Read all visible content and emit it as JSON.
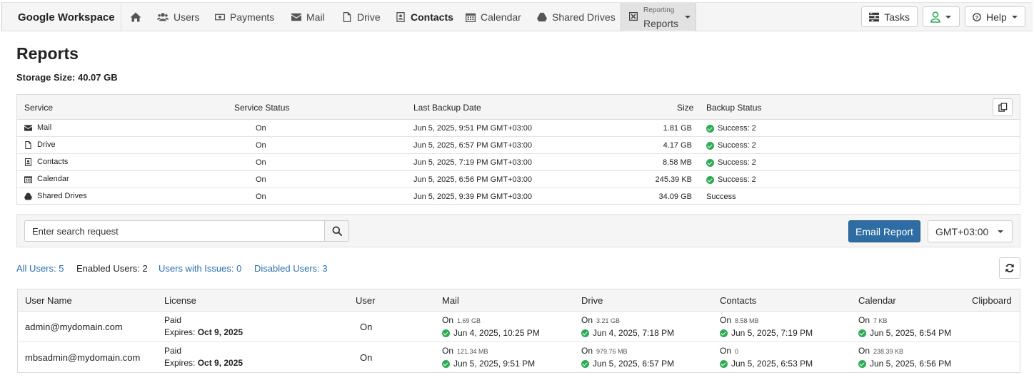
{
  "navbar": {
    "brand": "Google Workspace",
    "items": [
      {
        "label": "",
        "icon": "home-icon"
      },
      {
        "label": "Users",
        "icon": "users-icon"
      },
      {
        "label": "Payments",
        "icon": "payments-icon"
      },
      {
        "label": "Mail",
        "icon": "mail-icon"
      },
      {
        "label": "Drive",
        "icon": "drive-icon"
      },
      {
        "label": "Contacts",
        "icon": "contacts-icon"
      },
      {
        "label": "Calendar",
        "icon": "calendar-icon"
      },
      {
        "label": "Shared Drives",
        "icon": "shared-drives-icon"
      }
    ],
    "active_small": "Reporting",
    "active_label": "Reports",
    "tasks_label": "Tasks",
    "help_label": "Help"
  },
  "page": {
    "title": "Reports",
    "storage_label": "Storage Size:",
    "storage_value": "40.07 GB"
  },
  "service_table": {
    "headers": {
      "service": "Service",
      "status": "Service Status",
      "last_backup": "Last Backup Date",
      "size": "Size",
      "backup_status": "Backup Status"
    },
    "rows": [
      {
        "service": "Mail",
        "status": "On",
        "last_backup": "Jun 5, 2025, 9:51 PM GMT+03:00",
        "size": "1.81 GB",
        "backup_status": "Success: 2",
        "ok_icon": true
      },
      {
        "service": "Drive",
        "status": "On",
        "last_backup": "Jun 5, 2025, 6:57 PM GMT+03:00",
        "size": "4.17 GB",
        "backup_status": "Success: 2",
        "ok_icon": true
      },
      {
        "service": "Contacts",
        "status": "On",
        "last_backup": "Jun 5, 2025, 7:19 PM GMT+03:00",
        "size": "8.58 MB",
        "backup_status": "Success: 2",
        "ok_icon": true
      },
      {
        "service": "Calendar",
        "status": "On",
        "last_backup": "Jun 5, 2025, 6:56 PM GMT+03:00",
        "size": "245.39 KB",
        "backup_status": "Success: 2",
        "ok_icon": true
      },
      {
        "service": "Shared Drives",
        "status": "On",
        "last_backup": "Jun 5, 2025, 9:39 PM GMT+03:00",
        "size": "34.09 GB",
        "backup_status": "Success",
        "ok_icon": false
      }
    ]
  },
  "toolbar": {
    "search_placeholder": "Enter search request",
    "email_report": "Email Report",
    "timezone": "GMT+03:00"
  },
  "filters": {
    "all_users": "All Users: 5",
    "enabled_users": "Enabled Users: 2",
    "users_with_issues": "Users with Issues: 0",
    "disabled_users": "Disabled Users: 3"
  },
  "users_table": {
    "headers": {
      "user_name": "User Name",
      "license": "License",
      "user": "User",
      "mail": "Mail",
      "drive": "Drive",
      "contacts": "Contacts",
      "calendar": "Calendar",
      "clipboard": "Clipboard"
    },
    "rows": [
      {
        "user_name": "admin@mydomain.com",
        "license_type": "Paid",
        "expires_label": "Expires:",
        "expires_date": "Oct 9, 2025",
        "user": "On",
        "mail": {
          "status": "On",
          "size": "1.69 GB",
          "date": "Jun 4, 2025, 10:25 PM"
        },
        "drive": {
          "status": "On",
          "size": "3.21 GB",
          "date": "Jun 4, 2025, 7:18 PM"
        },
        "contacts": {
          "status": "On",
          "size": "8.58 MB",
          "date": "Jun 5, 2025, 7:19 PM"
        },
        "calendar": {
          "status": "On",
          "size": "7 KB",
          "date": "Jun 5, 2025, 6:54 PM"
        }
      },
      {
        "user_name": "mbsadmin@mydomain.com",
        "license_type": "Paid",
        "expires_label": "Expires:",
        "expires_date": "Oct 9, 2025",
        "user": "On",
        "mail": {
          "status": "On",
          "size": "121.34 MB",
          "date": "Jun 5, 2025, 9:51 PM"
        },
        "drive": {
          "status": "On",
          "size": "979.76 MB",
          "date": "Jun 5, 2025, 6:57 PM"
        },
        "contacts": {
          "status": "On",
          "size": "0",
          "date": "Jun 5, 2025, 6:53 PM"
        },
        "calendar": {
          "status": "On",
          "size": "238.39 KB",
          "date": "Jun 5, 2025, 6:56 PM"
        }
      }
    ]
  },
  "colors": {
    "primary": "#2e6da4",
    "link": "#2d6fb0",
    "success": "#2eab55",
    "user_icon": "#2eab55"
  }
}
